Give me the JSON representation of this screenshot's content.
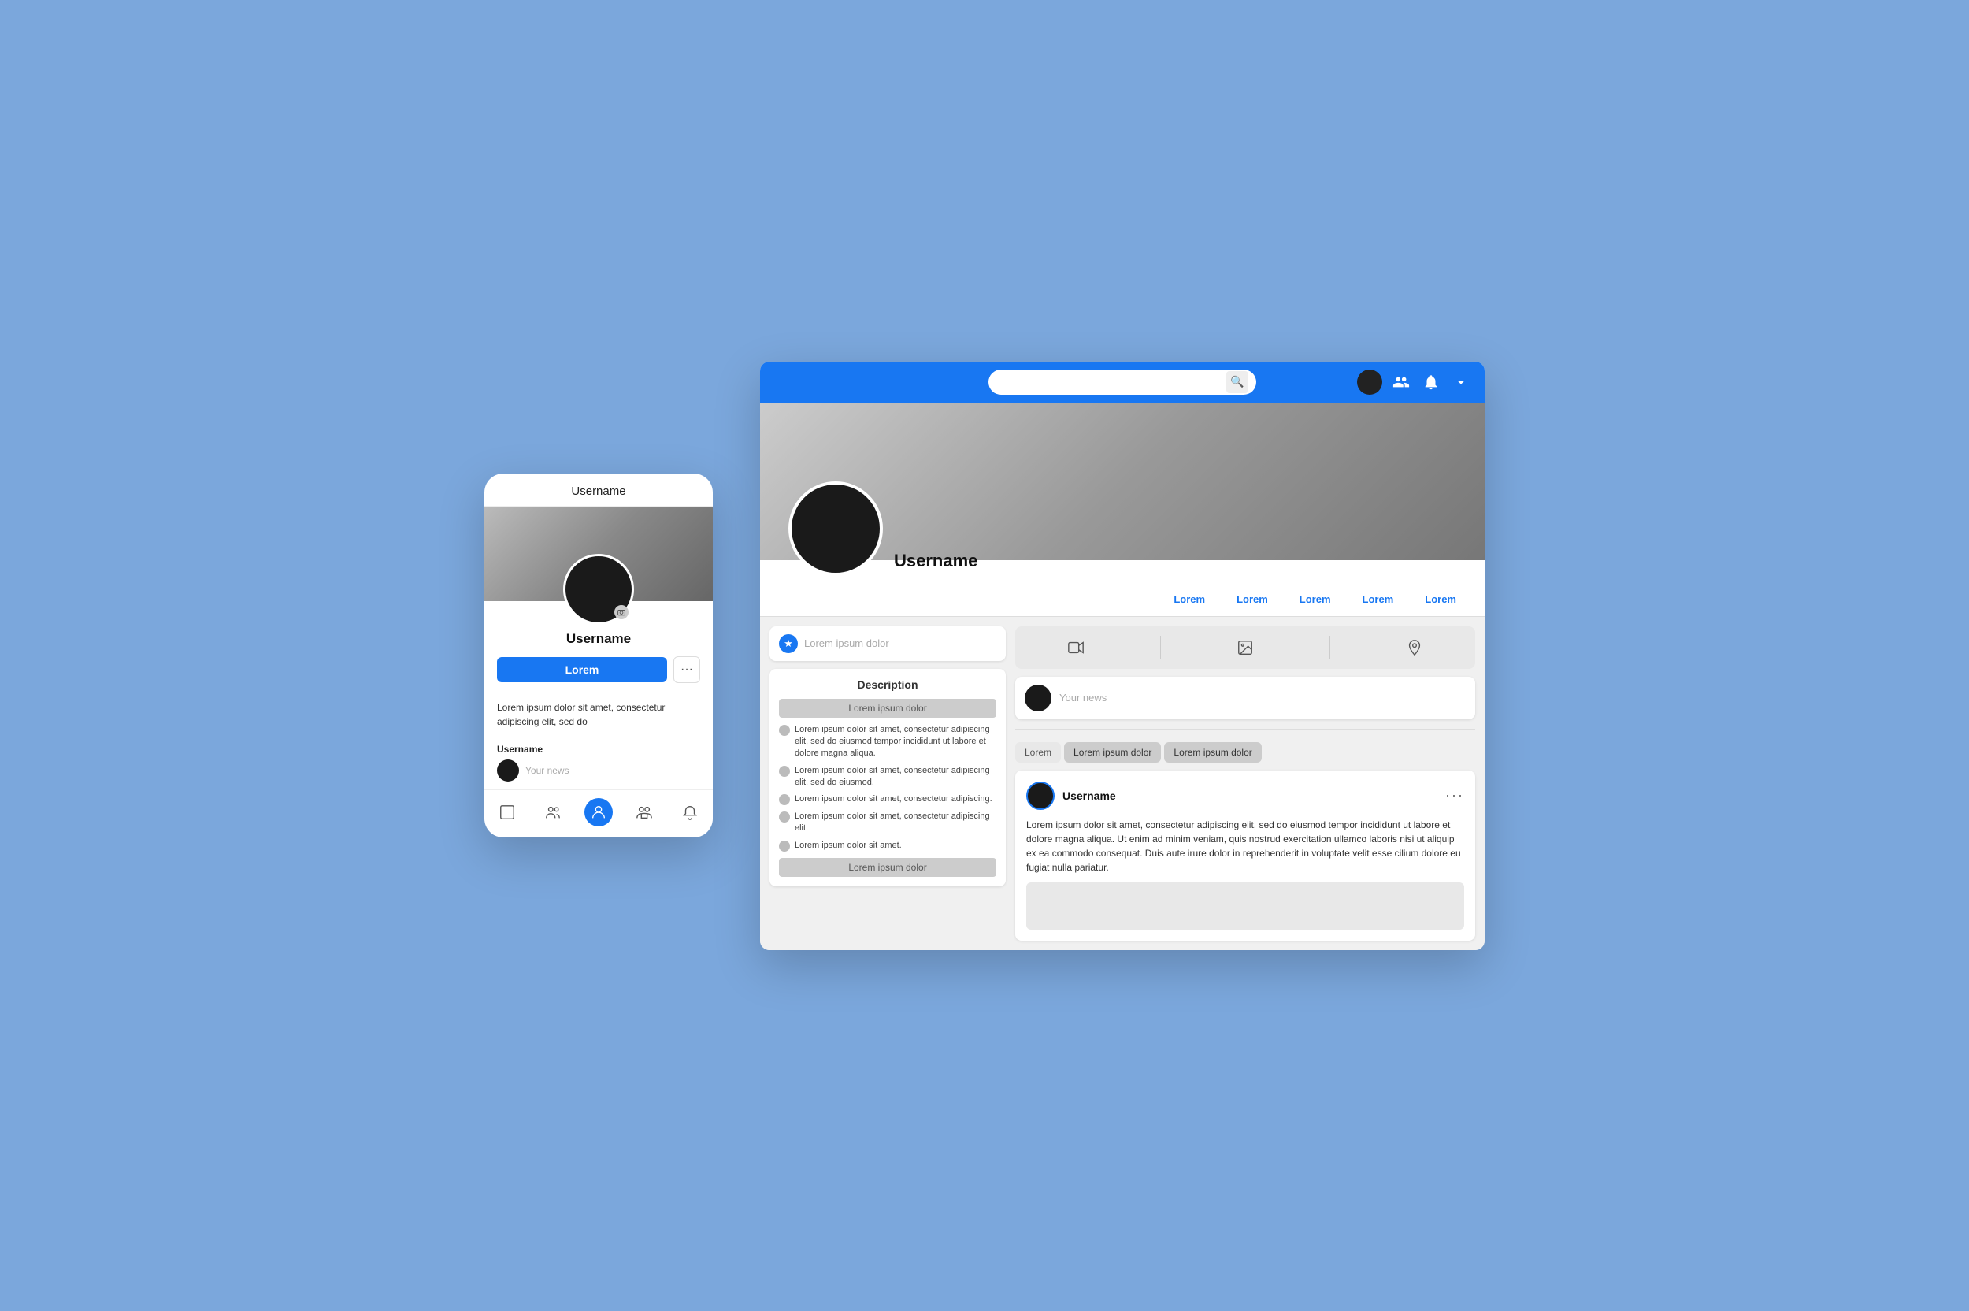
{
  "page": {
    "background_color": "#7ba7dc"
  },
  "mobile": {
    "header": {
      "title": "Username"
    },
    "profile": {
      "name": "Username",
      "button_label": "Lorem",
      "dots_label": "···",
      "bio": "Lorem ipsum dolor sit amet,\nconsectetur adipiscing elit, sed do"
    },
    "news": {
      "label": "Username",
      "placeholder": "Your news"
    },
    "nav": {
      "items": [
        {
          "name": "home",
          "label": "Home",
          "active": false
        },
        {
          "name": "friends",
          "label": "Friends",
          "active": false
        },
        {
          "name": "profile",
          "label": "Profile",
          "active": true
        },
        {
          "name": "groups",
          "label": "Groups",
          "active": false
        },
        {
          "name": "notifications",
          "label": "Notifications",
          "active": false
        }
      ]
    }
  },
  "desktop": {
    "topbar": {
      "search_placeholder": "",
      "search_icon": "🔍"
    },
    "profile": {
      "name": "Username",
      "tabs": [
        "Lorem",
        "Lorem",
        "Lorem",
        "Lorem",
        "Lorem"
      ]
    },
    "left": {
      "post_placeholder": "Lorem ipsum dolor",
      "description": {
        "title": "Description",
        "heading": "Lorem ipsum dolor",
        "items": [
          "Lorem ipsum dolor sit amet, consectetur adipiscing elit, sed do eiusmod tempor incididunt ut labore et dolore magna aliqua.",
          "Lorem ipsum dolor sit amet, consectetur adipiscing elit, sed do eiusmod.",
          "Lorem ipsum dolor sit amet, consectetur adipiscing.",
          "Lorem ipsum dolor sit amet, consectetur adipiscing elit.",
          "Lorem ipsum dolor sit amet."
        ],
        "footer": "Lorem ipsum dolor"
      }
    },
    "right": {
      "news_placeholder": "Your news",
      "media_icons": [
        "video",
        "image",
        "location"
      ],
      "tabs": {
        "left": "Lorem",
        "items": [
          "Lorem ipsum dolor",
          "Lorem ipsum dolor"
        ]
      },
      "post": {
        "username": "Username",
        "dots": "···",
        "text": "Lorem ipsum dolor sit amet, consectetur adipiscing elit, sed do eiusmod tempor incididunt ut labore et dolore magna aliqua. Ut enim ad minim veniam, quis nostrud exercitation ullamco laboris nisi ut aliquip ex ea commodo consequat. Duis aute irure dolor in reprehenderit in voluptate velit esse cilium dolore eu fugiat nulla pariatur."
      }
    }
  }
}
